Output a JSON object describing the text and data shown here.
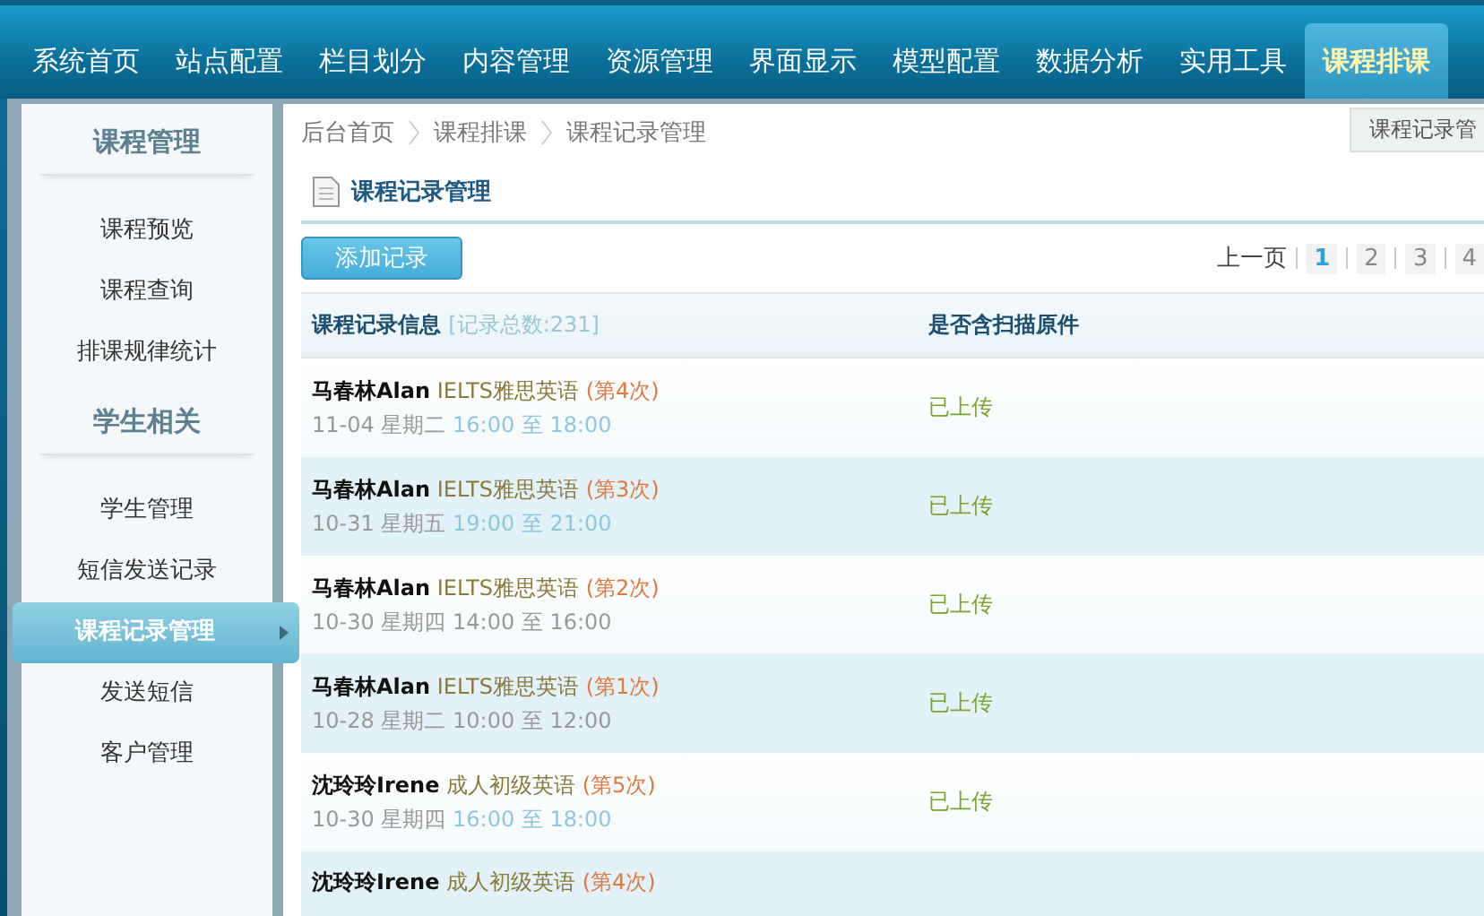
{
  "nav_tabs": [
    {
      "label": "系统首页",
      "selected": false
    },
    {
      "label": "站点配置",
      "selected": false
    },
    {
      "label": "栏目划分",
      "selected": false
    },
    {
      "label": "内容管理",
      "selected": false
    },
    {
      "label": "资源管理",
      "selected": false
    },
    {
      "label": "界面显示",
      "selected": false
    },
    {
      "label": "模型配置",
      "selected": false
    },
    {
      "label": "数据分析",
      "selected": false
    },
    {
      "label": "实用工具",
      "selected": false
    },
    {
      "label": "课程排课",
      "selected": true
    }
  ],
  "tooltip": "课程记录管",
  "sidebar": {
    "groups": [
      {
        "heading": "课程管理",
        "items": [
          {
            "label": "课程预览",
            "selected": false
          },
          {
            "label": "课程查询",
            "selected": false
          },
          {
            "label": "排课规律统计",
            "selected": false
          }
        ]
      },
      {
        "heading": "学生相关",
        "items": [
          {
            "label": "学生管理",
            "selected": false
          },
          {
            "label": "短信发送记录",
            "selected": false
          },
          {
            "label": "课程记录管理",
            "selected": true
          },
          {
            "label": "发送短信",
            "selected": false
          },
          {
            "label": "客户管理",
            "selected": false
          }
        ]
      }
    ]
  },
  "breadcrumb": [
    "后台首页",
    "课程排课",
    "课程记录管理"
  ],
  "page_title": "课程记录管理",
  "add_button": "添加记录",
  "pagination": {
    "prev": "上一页",
    "pages": [
      {
        "label": "1",
        "selected": true
      },
      {
        "label": "2",
        "selected": false
      },
      {
        "label": "3",
        "selected": false
      },
      {
        "label": "4",
        "selected": false
      }
    ]
  },
  "table": {
    "columns": [
      {
        "title": "课程记录信息",
        "note": "[记录总数:231]"
      },
      {
        "title": "是否含扫描原件"
      }
    ],
    "rows": [
      {
        "student": "马春林Alan",
        "course": "IELTS雅思英语",
        "lesson": "(第4次)",
        "date": "11-04 星期二",
        "time": "16:00 至 18:00",
        "time_highlighted": true,
        "scan": "已上传"
      },
      {
        "student": "马春林Alan",
        "course": "IELTS雅思英语",
        "lesson": "(第3次)",
        "date": "10-31 星期五",
        "time": "19:00 至 21:00",
        "time_highlighted": true,
        "scan": "已上传"
      },
      {
        "student": "马春林Alan",
        "course": "IELTS雅思英语",
        "lesson": "(第2次)",
        "date": "10-30 星期四",
        "time": "14:00 至 16:00",
        "time_highlighted": false,
        "scan": "已上传"
      },
      {
        "student": "马春林Alan",
        "course": "IELTS雅思英语",
        "lesson": "(第1次)",
        "date": "10-28 星期二",
        "time": "10:00 至 12:00",
        "time_highlighted": false,
        "scan": "已上传"
      },
      {
        "student": "沈玲玲Irene",
        "course": "成人初级英语",
        "lesson": "(第5次)",
        "date": "10-30 星期四",
        "time": "16:00 至 18:00",
        "time_highlighted": true,
        "scan": "已上传"
      },
      {
        "student": "沈玲玲Irene",
        "course": "成人初级英语",
        "lesson": "(第4次)"
      }
    ]
  }
}
